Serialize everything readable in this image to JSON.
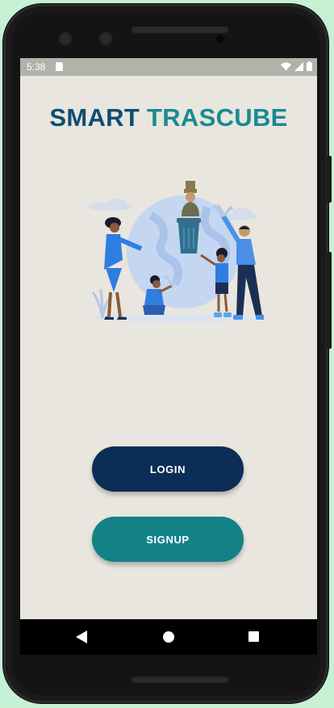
{
  "status_bar": {
    "time": "5:38"
  },
  "app": {
    "title_part1": "SMART",
    "title_part2": "TRASCUBE"
  },
  "buttons": {
    "login_label": "LOGIN",
    "signup_label": "SIGNUP"
  },
  "colors": {
    "background": "#e8e6de",
    "title_dark": "#0d4d73",
    "title_teal": "#1a8b92",
    "login_button": "#0c2d55",
    "signup_button": "#128288"
  },
  "icons": [
    "sd-card-icon",
    "wifi-icon",
    "signal-icon",
    "battery-icon",
    "back-icon",
    "home-icon",
    "recent-apps-icon"
  ]
}
